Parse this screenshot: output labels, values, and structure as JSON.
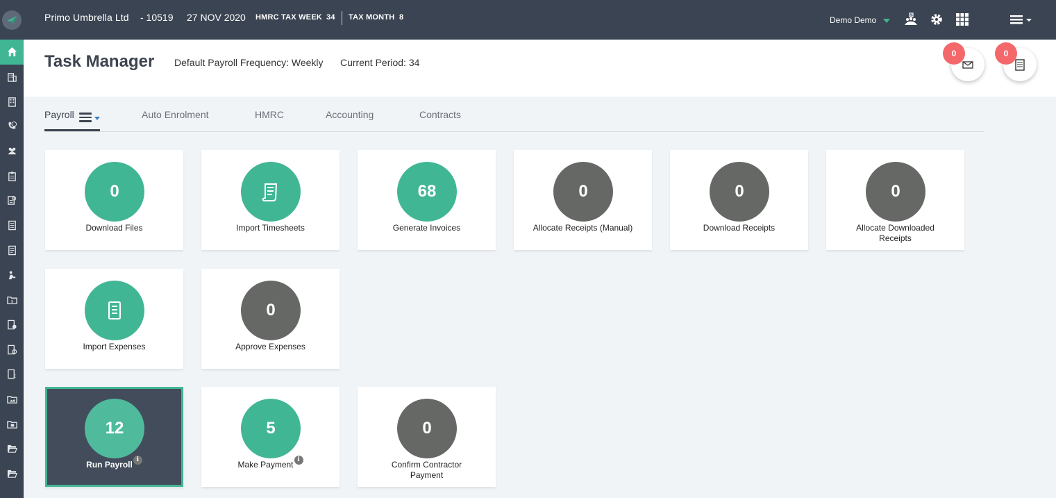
{
  "topbar": {
    "company": "Primo Umbrella Ltd",
    "code": "- 10519",
    "date": "27 NOV 2020",
    "tax_week_label": "HMRC TAX WEEK",
    "tax_week_value": "34",
    "tax_month_label": "TAX MONTH",
    "tax_month_value": "8",
    "user": "Demo Demo"
  },
  "header": {
    "title": "Task Manager",
    "frequency": "Default Payroll Frequency: Weekly",
    "period": "Current Period: 34",
    "messages_badge": "0",
    "documents_badge": "0"
  },
  "tabs": [
    {
      "label": "Payroll"
    },
    {
      "label": "Auto Enrolment"
    },
    {
      "label": "HMRC"
    },
    {
      "label": "Accounting"
    },
    {
      "label": "Contracts"
    }
  ],
  "cards": [
    {
      "count": "0",
      "label": "Download Files"
    },
    {
      "count": "",
      "label": "Import Timesheets"
    },
    {
      "count": "68",
      "label": "Generate Invoices"
    },
    {
      "count": "0",
      "label": "Allocate Receipts (Manual)"
    },
    {
      "count": "0",
      "label": "Download Receipts"
    },
    {
      "count": "0",
      "label": "Allocate Downloaded Receipts"
    },
    {
      "count": "",
      "label": "Import Expenses"
    },
    {
      "count": "0",
      "label": "Approve Expenses"
    },
    {
      "count": "12",
      "label": "Run Payroll"
    },
    {
      "count": "5",
      "label": "Make Payment"
    },
    {
      "count": "0",
      "label": "Confirm Contractor Payment"
    }
  ],
  "info_glyph": "i",
  "colors": {
    "accent": "#41b695",
    "dark": "#3b4452",
    "grey_disc": "#666866",
    "badge": "#f4676a"
  }
}
